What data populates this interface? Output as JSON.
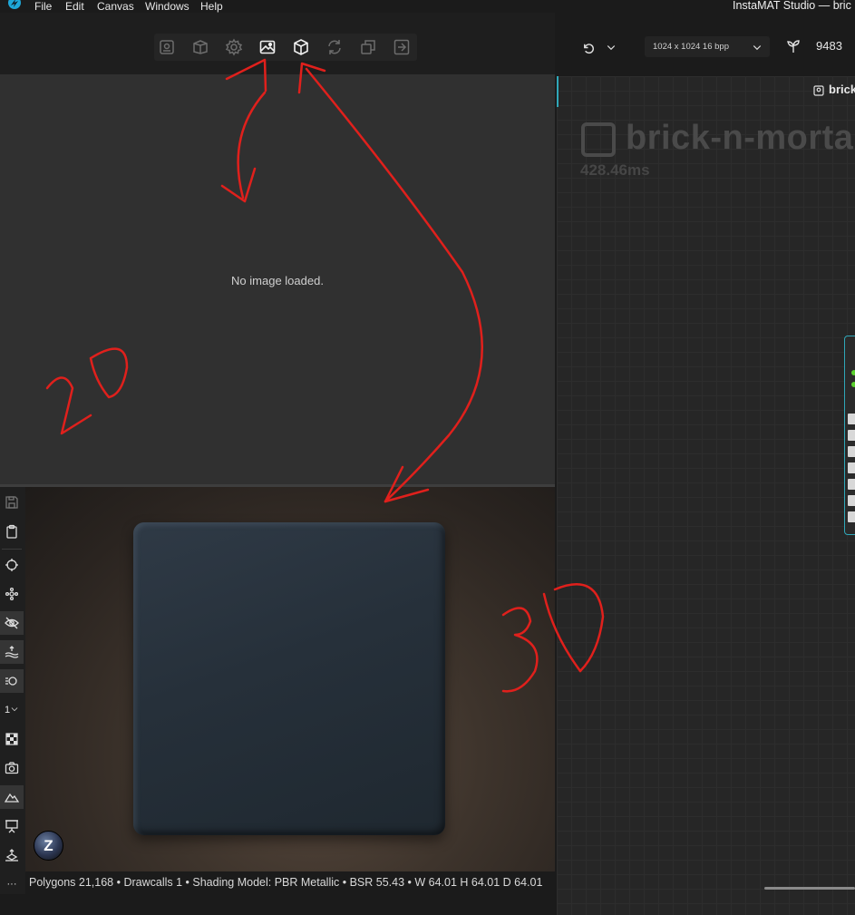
{
  "menubar": {
    "app_logo": "instamat-logo-icon",
    "items": [
      "File",
      "Edit",
      "Canvas",
      "Windows",
      "Help"
    ],
    "window_title": "InstaMAT Studio — bric"
  },
  "view_toolbar": {
    "buttons": [
      {
        "icon": "node-graph-icon"
      },
      {
        "icon": "open-box-icon"
      },
      {
        "icon": "settings-gear-icon"
      },
      {
        "icon": "image-2d-icon"
      },
      {
        "icon": "cube-3d-icon"
      },
      {
        "icon": "refresh-icon"
      },
      {
        "icon": "windows-stack-icon"
      },
      {
        "icon": "export-arrow-icon"
      }
    ]
  },
  "view2d": {
    "empty_message": "No image loaded."
  },
  "view3d": {
    "z_badge": "Z"
  },
  "side_tools": [
    {
      "icon": "save-icon"
    },
    {
      "icon": "clipboard-icon"
    },
    {
      "icon": "crosshair-icon"
    },
    {
      "icon": "node-tree-icon"
    },
    {
      "icon": "eye-visibility-icon"
    },
    {
      "icon": "water-surface-icon"
    },
    {
      "icon": "lighting-icon"
    },
    {
      "icon": "uv-set-icon",
      "text": "1"
    },
    {
      "icon": "checker-icon"
    },
    {
      "icon": "camera-icon"
    },
    {
      "icon": "terrain-icon"
    },
    {
      "icon": "presentation-icon"
    },
    {
      "icon": "pedestal-icon"
    },
    {
      "icon": "more-icon",
      "text": "···"
    }
  ],
  "status": {
    "text": "Polygons 21,168 • Drawcalls 1 • Shading Model: PBR Metallic • BSR 55.43 • W 64.01 H 64.01 D 64.01"
  },
  "right_toolbar": {
    "resolution": "1024 x 1024 16 bpp",
    "seed": "9483"
  },
  "graph": {
    "tab_label": "brick",
    "title": "brick-n-morta",
    "exec_time": "428.46ms"
  },
  "annotations": {
    "label_2d": "2D",
    "label_3d": "3D",
    "color": "#e0201c"
  }
}
